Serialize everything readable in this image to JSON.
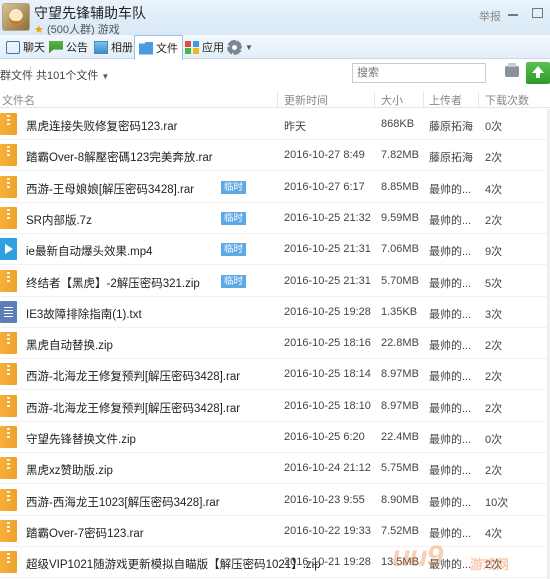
{
  "window": {
    "group_name": "守望先锋辅助车队",
    "group_meta": "(500人群) 游戏",
    "report_label": "举报"
  },
  "tabs": [
    {
      "label": "聊天",
      "icon": "chat-icon"
    },
    {
      "label": "公告",
      "icon": "notice-icon"
    },
    {
      "label": "相册",
      "icon": "album-icon"
    },
    {
      "label": "文件",
      "icon": "folder-icon",
      "active": true
    },
    {
      "label": "应用",
      "icon": "app-icon"
    },
    {
      "label": "",
      "icon": "settings-gear-icon"
    }
  ],
  "toolbar": {
    "group_files_label": "群文件",
    "count_label": "共101个文件",
    "search_placeholder": "搜索"
  },
  "columns": {
    "name": "文件名",
    "time": "更新时间",
    "size": "大小",
    "uploader": "上传者",
    "downloads": "下载次数"
  },
  "files": [
    {
      "name": "黑虎连接失败修复密码123.rar",
      "type": "zip",
      "badge": "",
      "time": "昨天",
      "size": "868KB",
      "uploader": "藤原拓海",
      "downloads": "0次"
    },
    {
      "name": "踏霸Over-8解壓密碼123完美奔放.rar",
      "type": "zip",
      "badge": "",
      "time": "2016-10-27 8:49",
      "size": "7.82MB",
      "uploader": "藤原拓海",
      "downloads": "2次"
    },
    {
      "name": "西游-王母娘娘[解压密码3428].rar",
      "type": "zip",
      "badge": "临时",
      "time": "2016-10-27 6:17",
      "size": "8.85MB",
      "uploader": "最帅的...",
      "downloads": "4次"
    },
    {
      "name": "SR内部版.7z",
      "type": "zip",
      "badge": "临时",
      "time": "2016-10-25 21:32",
      "size": "9.59MB",
      "uploader": "最帅的...",
      "downloads": "2次"
    },
    {
      "name": "ie最新自动爆头效果.mp4",
      "type": "video",
      "badge": "临时",
      "time": "2016-10-25 21:31",
      "size": "7.06MB",
      "uploader": "最帅的...",
      "downloads": "9次"
    },
    {
      "name": "终结者【黑虎】-2解压密码321.zip",
      "type": "zip",
      "badge": "临时",
      "time": "2016-10-25 21:31",
      "size": "5.70MB",
      "uploader": "最帅的...",
      "downloads": "5次"
    },
    {
      "name": "IE3故障排除指南(1).txt",
      "type": "txt",
      "badge": "",
      "time": "2016-10-25 19:28",
      "size": "1.35KB",
      "uploader": "最帅的...",
      "downloads": "3次"
    },
    {
      "name": "黑虎自动替换.zip",
      "type": "zip",
      "badge": "",
      "time": "2016-10-25 18:16",
      "size": "22.8MB",
      "uploader": "最帅的...",
      "downloads": "2次"
    },
    {
      "name": "西游-北海龙王修复预判[解压密码3428].rar",
      "type": "zip",
      "badge": "",
      "time": "2016-10-25 18:14",
      "size": "8.97MB",
      "uploader": "最帅的...",
      "downloads": "2次"
    },
    {
      "name": "西游-北海龙王修复预判[解压密码3428].rar",
      "type": "zip",
      "badge": "",
      "time": "2016-10-25 18:10",
      "size": "8.97MB",
      "uploader": "最帅的...",
      "downloads": "2次"
    },
    {
      "name": "守望先锋替换文件.zip",
      "type": "zip",
      "badge": "",
      "time": "2016-10-25 6:20",
      "size": "22.4MB",
      "uploader": "最帅的...",
      "downloads": "0次"
    },
    {
      "name": "黑虎xz赞助版.zip",
      "type": "zip",
      "badge": "",
      "time": "2016-10-24 21:12",
      "size": "5.75MB",
      "uploader": "最帅的...",
      "downloads": "2次"
    },
    {
      "name": "西游-西海龙王1023[解压密码3428].rar",
      "type": "zip",
      "badge": "",
      "time": "2016-10-23 9:55",
      "size": "8.90MB",
      "uploader": "最帅的...",
      "downloads": "10次"
    },
    {
      "name": "踏霸Over-7密码123.rar",
      "type": "zip",
      "badge": "",
      "time": "2016-10-22 19:33",
      "size": "7.52MB",
      "uploader": "最帅的...",
      "downloads": "4次"
    },
    {
      "name": "超级VIP1021随游戏更新模拟自瞄版【解压密码1021】.zip",
      "type": "zip",
      "badge": "",
      "time": "2016-10-21 19:28",
      "size": "13.5MB",
      "uploader": "最帅的...",
      "downloads": "2次"
    }
  ],
  "watermark": {
    "main": "uu9",
    "sub": "游戏网"
  }
}
